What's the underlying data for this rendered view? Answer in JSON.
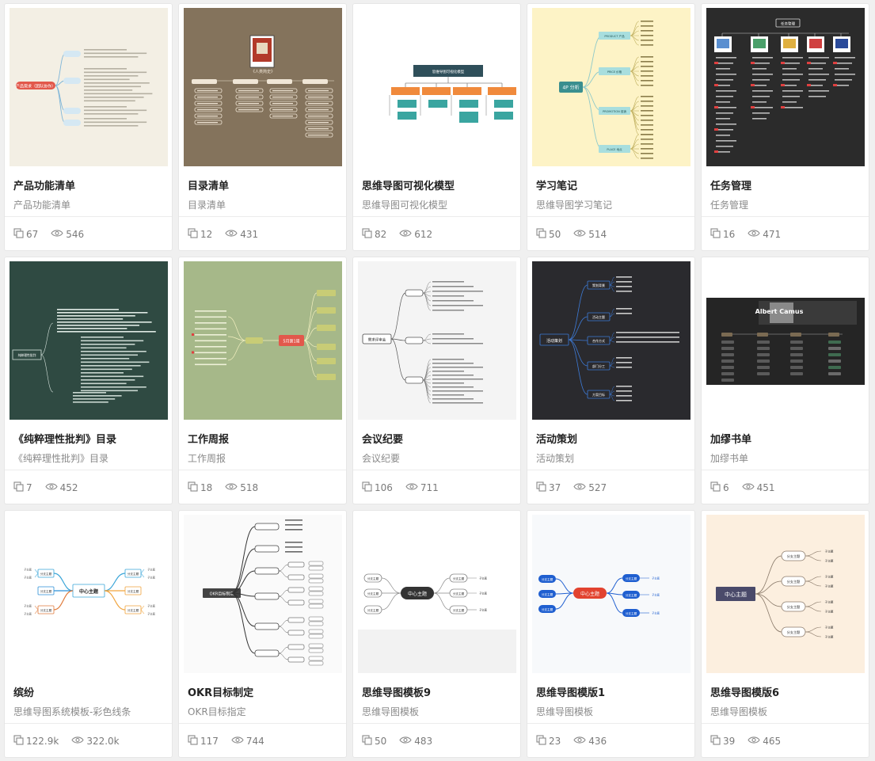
{
  "cards": [
    {
      "title": "产品功能清单",
      "subtitle": "产品功能清单",
      "copies": "67",
      "views": "546",
      "thumb": {
        "type": "logic",
        "bg": "#f3efe4",
        "root_label": "产品需求（团队协作）",
        "root_color": "#e2584b",
        "line_color": "#7fb6d8"
      }
    },
    {
      "title": "目录清单",
      "subtitle": "目录清单",
      "copies": "12",
      "views": "431",
      "thumb": {
        "type": "catalog",
        "bg": "#84735c",
        "book_title": "《人类简史》",
        "line_color": "#f0e6d6"
      }
    },
    {
      "title": "思维导图可视化模型",
      "subtitle": "思维导图可视化模型",
      "copies": "82",
      "views": "612",
      "thumb": {
        "type": "org",
        "bg": "#ffffff",
        "root_label": "思维导图可视化模型",
        "root_color": "#2f4f5a",
        "branch_colors": [
          "#f08a3c",
          "#f08a3c",
          "#f08a3c",
          "#f08a3c"
        ],
        "leaf_color": "#3aa5a0"
      }
    },
    {
      "title": "学习笔记",
      "subtitle": "思维导图学习笔记",
      "copies": "50",
      "views": "514",
      "thumb": {
        "type": "fourp",
        "bg": "#fdf3c6",
        "root_label": "4P 分析",
        "root_color": "#3a8f8f",
        "branches": [
          "PRODUCT 产品",
          "PRICE 价格",
          "PROMOTION 促销",
          "PLACE 地点"
        ],
        "branch_color": "#a8dede"
      }
    },
    {
      "title": "任务管理",
      "subtitle": "任务管理",
      "copies": "16",
      "views": "471",
      "thumb": {
        "type": "tasks",
        "bg": "#2b2b2b",
        "root_label": "任务管理",
        "line_color": "#cccccc"
      }
    },
    {
      "title": "《纯粹理性批判》目录",
      "subtitle": "《纯粹理性批判》目录",
      "copies": "7",
      "views": "452",
      "thumb": {
        "type": "critique",
        "bg": "#2f4a42",
        "root_label": "纯粹理性批判",
        "line_color": "#d8e4de"
      }
    },
    {
      "title": "工作周报",
      "subtitle": "工作周报",
      "copies": "18",
      "views": "518",
      "thumb": {
        "type": "weekly",
        "bg": "#a6b889",
        "root_label": "5月第1周",
        "root_color": "#e2584b",
        "node_color": "#c8cc76"
      }
    },
    {
      "title": "会议纪要",
      "subtitle": "会议纪要",
      "copies": "106",
      "views": "711",
      "thumb": {
        "type": "meeting",
        "bg": "#f4f4f4",
        "root_label": "需求评审会",
        "line_color": "#555555"
      }
    },
    {
      "title": "活动策划",
      "subtitle": "活动策划",
      "copies": "37",
      "views": "527",
      "thumb": {
        "type": "event",
        "bg": "#2a2a2e",
        "root_label": "活动策划",
        "branches": [
          "策划背景",
          "活动主题",
          "合作方式",
          "部门分工",
          "方案目标"
        ],
        "line_color": "#3d7ad6"
      }
    },
    {
      "title": "加缪书单",
      "subtitle": "加缪书单",
      "copies": "6",
      "views": "451",
      "thumb": {
        "type": "camus",
        "bg": "#ffffff",
        "banner_text": "Albert Camus",
        "banner_color": "#3a3a3a"
      }
    },
    {
      "title": "缤纷",
      "subtitle": "思维导图系统模板-彩色线条",
      "copies": "122.9k",
      "views": "322.0k",
      "thumb": {
        "type": "colorful",
        "bg": "#ffffff",
        "root_label": "中心主题",
        "branch_label": "分支主题",
        "leaf_label": "子主题",
        "colors": [
          "#3aa5d8",
          "#f0a33c",
          "#2b8fd6",
          "#e07b3c"
        ]
      }
    },
    {
      "title": "OKR目标制定",
      "subtitle": "OKR目标指定",
      "copies": "117",
      "views": "744",
      "thumb": {
        "type": "okr",
        "bg": "#fafafa",
        "root_label": "OKR目标制定",
        "root_color": "#444444"
      }
    },
    {
      "title": "思维导图模板9",
      "subtitle": "思维导图模板",
      "copies": "50",
      "views": "483",
      "thumb": {
        "type": "tmpl9",
        "bg": "#ffffff",
        "root_label": "中心主题",
        "branch_label": "分支主题",
        "leaf_label": "子主题",
        "root_color": "#333333"
      }
    },
    {
      "title": "思维导图模版1",
      "subtitle": "思维导图模板",
      "copies": "23",
      "views": "436",
      "thumb": {
        "type": "tmpl1",
        "bg": "#f7f9fb",
        "root_label": "中心主题",
        "branch_label": "分支主题",
        "leaf_label": "子主题",
        "root_color": "#e2432f",
        "branch_color": "#1f5fd0"
      }
    },
    {
      "title": "思维导图模版6",
      "subtitle": "思维导图模板",
      "copies": "39",
      "views": "465",
      "thumb": {
        "type": "tmpl6",
        "bg": "#fcefdf",
        "root_label": "中心主题",
        "branch_label": "分支主题",
        "leaf_label": "子主题",
        "root_color": "#4a4a6a"
      }
    }
  ]
}
